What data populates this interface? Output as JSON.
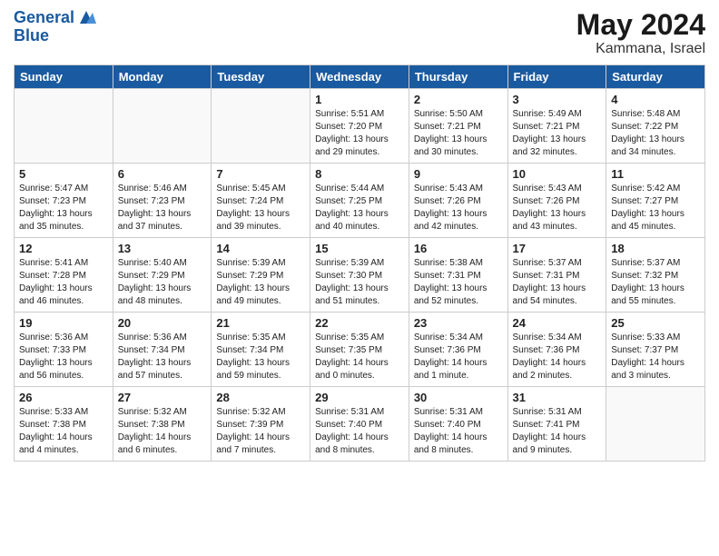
{
  "header": {
    "logo_line1": "General",
    "logo_line2": "Blue",
    "month": "May 2024",
    "location": "Kammana, Israel"
  },
  "weekdays": [
    "Sunday",
    "Monday",
    "Tuesday",
    "Wednesday",
    "Thursday",
    "Friday",
    "Saturday"
  ],
  "weeks": [
    [
      {
        "day": "",
        "sunrise": "",
        "sunset": "",
        "daylight": ""
      },
      {
        "day": "",
        "sunrise": "",
        "sunset": "",
        "daylight": ""
      },
      {
        "day": "",
        "sunrise": "",
        "sunset": "",
        "daylight": ""
      },
      {
        "day": "1",
        "sunrise": "Sunrise: 5:51 AM",
        "sunset": "Sunset: 7:20 PM",
        "daylight": "Daylight: 13 hours and 29 minutes."
      },
      {
        "day": "2",
        "sunrise": "Sunrise: 5:50 AM",
        "sunset": "Sunset: 7:21 PM",
        "daylight": "Daylight: 13 hours and 30 minutes."
      },
      {
        "day": "3",
        "sunrise": "Sunrise: 5:49 AM",
        "sunset": "Sunset: 7:21 PM",
        "daylight": "Daylight: 13 hours and 32 minutes."
      },
      {
        "day": "4",
        "sunrise": "Sunrise: 5:48 AM",
        "sunset": "Sunset: 7:22 PM",
        "daylight": "Daylight: 13 hours and 34 minutes."
      }
    ],
    [
      {
        "day": "5",
        "sunrise": "Sunrise: 5:47 AM",
        "sunset": "Sunset: 7:23 PM",
        "daylight": "Daylight: 13 hours and 35 minutes."
      },
      {
        "day": "6",
        "sunrise": "Sunrise: 5:46 AM",
        "sunset": "Sunset: 7:23 PM",
        "daylight": "Daylight: 13 hours and 37 minutes."
      },
      {
        "day": "7",
        "sunrise": "Sunrise: 5:45 AM",
        "sunset": "Sunset: 7:24 PM",
        "daylight": "Daylight: 13 hours and 39 minutes."
      },
      {
        "day": "8",
        "sunrise": "Sunrise: 5:44 AM",
        "sunset": "Sunset: 7:25 PM",
        "daylight": "Daylight: 13 hours and 40 minutes."
      },
      {
        "day": "9",
        "sunrise": "Sunrise: 5:43 AM",
        "sunset": "Sunset: 7:26 PM",
        "daylight": "Daylight: 13 hours and 42 minutes."
      },
      {
        "day": "10",
        "sunrise": "Sunrise: 5:43 AM",
        "sunset": "Sunset: 7:26 PM",
        "daylight": "Daylight: 13 hours and 43 minutes."
      },
      {
        "day": "11",
        "sunrise": "Sunrise: 5:42 AM",
        "sunset": "Sunset: 7:27 PM",
        "daylight": "Daylight: 13 hours and 45 minutes."
      }
    ],
    [
      {
        "day": "12",
        "sunrise": "Sunrise: 5:41 AM",
        "sunset": "Sunset: 7:28 PM",
        "daylight": "Daylight: 13 hours and 46 minutes."
      },
      {
        "day": "13",
        "sunrise": "Sunrise: 5:40 AM",
        "sunset": "Sunset: 7:29 PM",
        "daylight": "Daylight: 13 hours and 48 minutes."
      },
      {
        "day": "14",
        "sunrise": "Sunrise: 5:39 AM",
        "sunset": "Sunset: 7:29 PM",
        "daylight": "Daylight: 13 hours and 49 minutes."
      },
      {
        "day": "15",
        "sunrise": "Sunrise: 5:39 AM",
        "sunset": "Sunset: 7:30 PM",
        "daylight": "Daylight: 13 hours and 51 minutes."
      },
      {
        "day": "16",
        "sunrise": "Sunrise: 5:38 AM",
        "sunset": "Sunset: 7:31 PM",
        "daylight": "Daylight: 13 hours and 52 minutes."
      },
      {
        "day": "17",
        "sunrise": "Sunrise: 5:37 AM",
        "sunset": "Sunset: 7:31 PM",
        "daylight": "Daylight: 13 hours and 54 minutes."
      },
      {
        "day": "18",
        "sunrise": "Sunrise: 5:37 AM",
        "sunset": "Sunset: 7:32 PM",
        "daylight": "Daylight: 13 hours and 55 minutes."
      }
    ],
    [
      {
        "day": "19",
        "sunrise": "Sunrise: 5:36 AM",
        "sunset": "Sunset: 7:33 PM",
        "daylight": "Daylight: 13 hours and 56 minutes."
      },
      {
        "day": "20",
        "sunrise": "Sunrise: 5:36 AM",
        "sunset": "Sunset: 7:34 PM",
        "daylight": "Daylight: 13 hours and 57 minutes."
      },
      {
        "day": "21",
        "sunrise": "Sunrise: 5:35 AM",
        "sunset": "Sunset: 7:34 PM",
        "daylight": "Daylight: 13 hours and 59 minutes."
      },
      {
        "day": "22",
        "sunrise": "Sunrise: 5:35 AM",
        "sunset": "Sunset: 7:35 PM",
        "daylight": "Daylight: 14 hours and 0 minutes."
      },
      {
        "day": "23",
        "sunrise": "Sunrise: 5:34 AM",
        "sunset": "Sunset: 7:36 PM",
        "daylight": "Daylight: 14 hours and 1 minute."
      },
      {
        "day": "24",
        "sunrise": "Sunrise: 5:34 AM",
        "sunset": "Sunset: 7:36 PM",
        "daylight": "Daylight: 14 hours and 2 minutes."
      },
      {
        "day": "25",
        "sunrise": "Sunrise: 5:33 AM",
        "sunset": "Sunset: 7:37 PM",
        "daylight": "Daylight: 14 hours and 3 minutes."
      }
    ],
    [
      {
        "day": "26",
        "sunrise": "Sunrise: 5:33 AM",
        "sunset": "Sunset: 7:38 PM",
        "daylight": "Daylight: 14 hours and 4 minutes."
      },
      {
        "day": "27",
        "sunrise": "Sunrise: 5:32 AM",
        "sunset": "Sunset: 7:38 PM",
        "daylight": "Daylight: 14 hours and 6 minutes."
      },
      {
        "day": "28",
        "sunrise": "Sunrise: 5:32 AM",
        "sunset": "Sunset: 7:39 PM",
        "daylight": "Daylight: 14 hours and 7 minutes."
      },
      {
        "day": "29",
        "sunrise": "Sunrise: 5:31 AM",
        "sunset": "Sunset: 7:40 PM",
        "daylight": "Daylight: 14 hours and 8 minutes."
      },
      {
        "day": "30",
        "sunrise": "Sunrise: 5:31 AM",
        "sunset": "Sunset: 7:40 PM",
        "daylight": "Daylight: 14 hours and 8 minutes."
      },
      {
        "day": "31",
        "sunrise": "Sunrise: 5:31 AM",
        "sunset": "Sunset: 7:41 PM",
        "daylight": "Daylight: 14 hours and 9 minutes."
      },
      {
        "day": "",
        "sunrise": "",
        "sunset": "",
        "daylight": ""
      }
    ]
  ]
}
